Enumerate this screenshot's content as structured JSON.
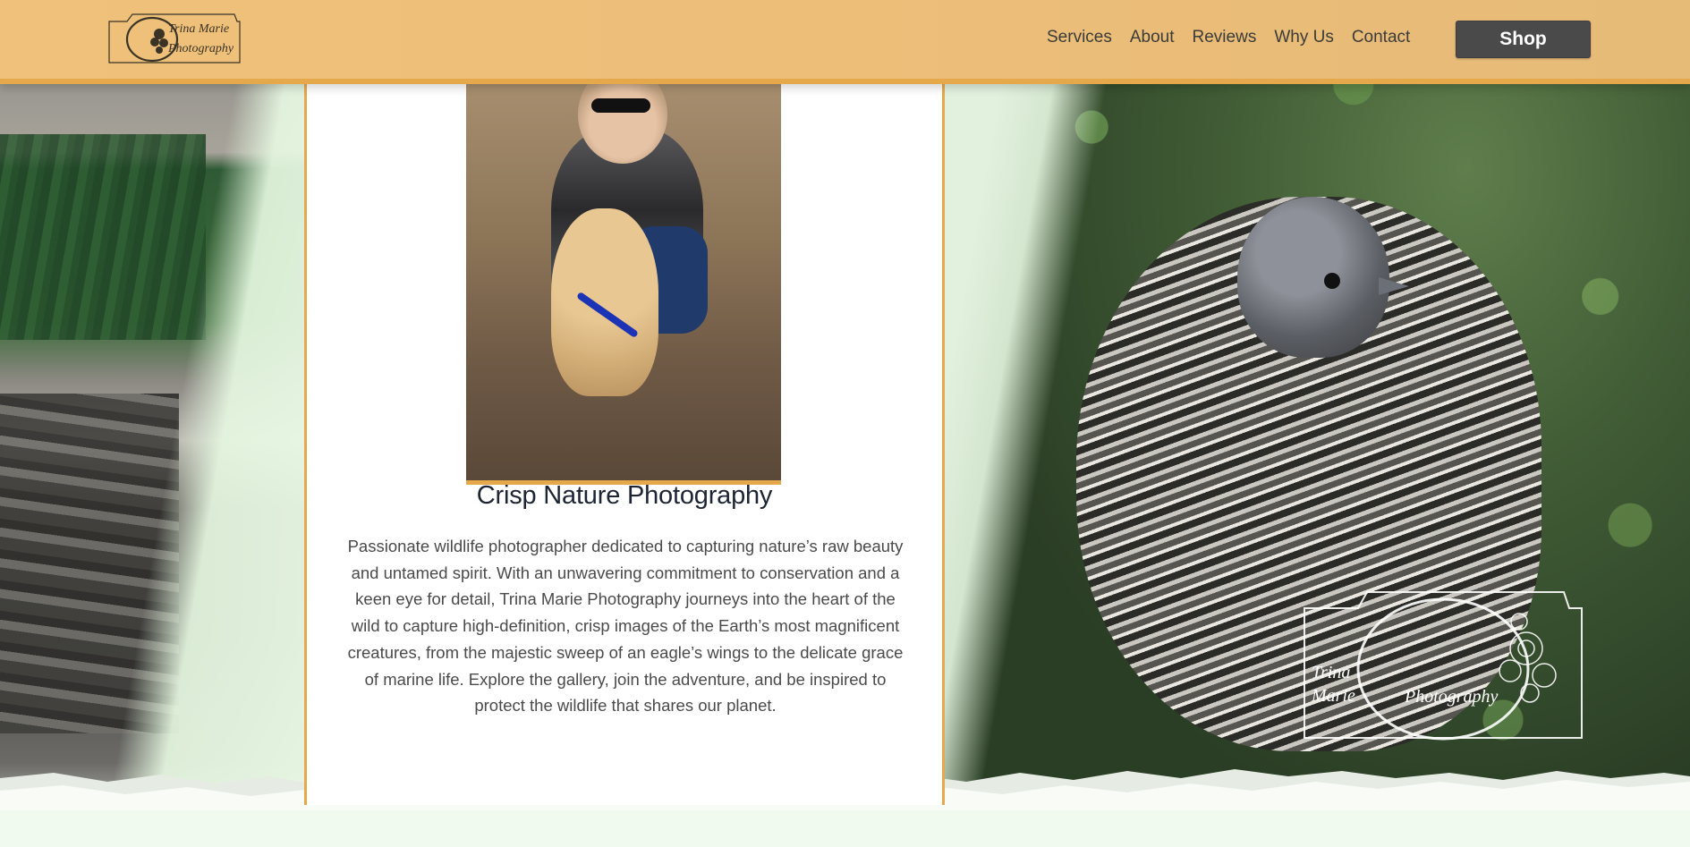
{
  "header": {
    "logo_line1": "Trina Marie",
    "logo_line2": "Photography",
    "nav": [
      {
        "label": "Services"
      },
      {
        "label": "About"
      },
      {
        "label": "Reviews"
      },
      {
        "label": "Why Us"
      },
      {
        "label": "Contact"
      }
    ],
    "shop_label": "Shop"
  },
  "main": {
    "title": "Crisp Nature Photography",
    "description": "Passionate wildlife photographer dedicated to capturing nature’s raw beauty and untamed spirit. With an unwavering commitment to conservation and a keen eye for detail, Trina Marie Photography journeys into the heart of the wild to capture high-definition, crisp images of the Earth’s most magnificent creatures, from the majestic sweep of an eagle’s wings to the delicate grace of marine life. Explore the gallery, join the adventure, and be inspired to protect the wildlife that shares our planet."
  },
  "watermark": {
    "line1": "Trina",
    "line2": "Marie",
    "line3": "Photography"
  },
  "colors": {
    "header_bg": "#ebbd78",
    "accent_border": "#e5a94b",
    "shop_bg": "#4a4a4a",
    "title_text": "#1d2535",
    "body_text": "#4a4a4a"
  }
}
